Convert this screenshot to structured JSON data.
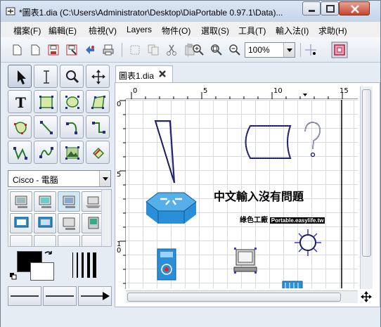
{
  "window": {
    "title": "*圖表1.dia (C:\\Users\\Administrator\\Desktop\\DiaPortable 0.97.1\\Data)..."
  },
  "menubar": {
    "items": [
      "檔案(F)",
      "編輯(E)",
      "檢視(V)",
      "Layers",
      "物件(O)",
      "選取(S)",
      "工具(T)",
      "輸入法(I)",
      "求助(H)"
    ]
  },
  "toolbar": {
    "zoom_value": "100%"
  },
  "sheet": {
    "selected": "Cisco - 電腦"
  },
  "tabs": [
    {
      "label": "圖表1.dia"
    }
  ],
  "rulers": {
    "top": [
      "0",
      "5",
      "10",
      "15"
    ],
    "left": [
      "0",
      "5",
      "10"
    ]
  },
  "canvas": {
    "text_object": "中文輸入沒有問題",
    "logo_text": "綠色工廠",
    "logo_subtext": "Portable.easylife.tw"
  },
  "colors": {
    "titlebar_top": "#dbe6f3",
    "titlebar_bottom": "#c5d6ea",
    "shape_outline": "#26266b",
    "router_blue": "#2a8fd8",
    "handle_blue": "#3a3ac8"
  }
}
